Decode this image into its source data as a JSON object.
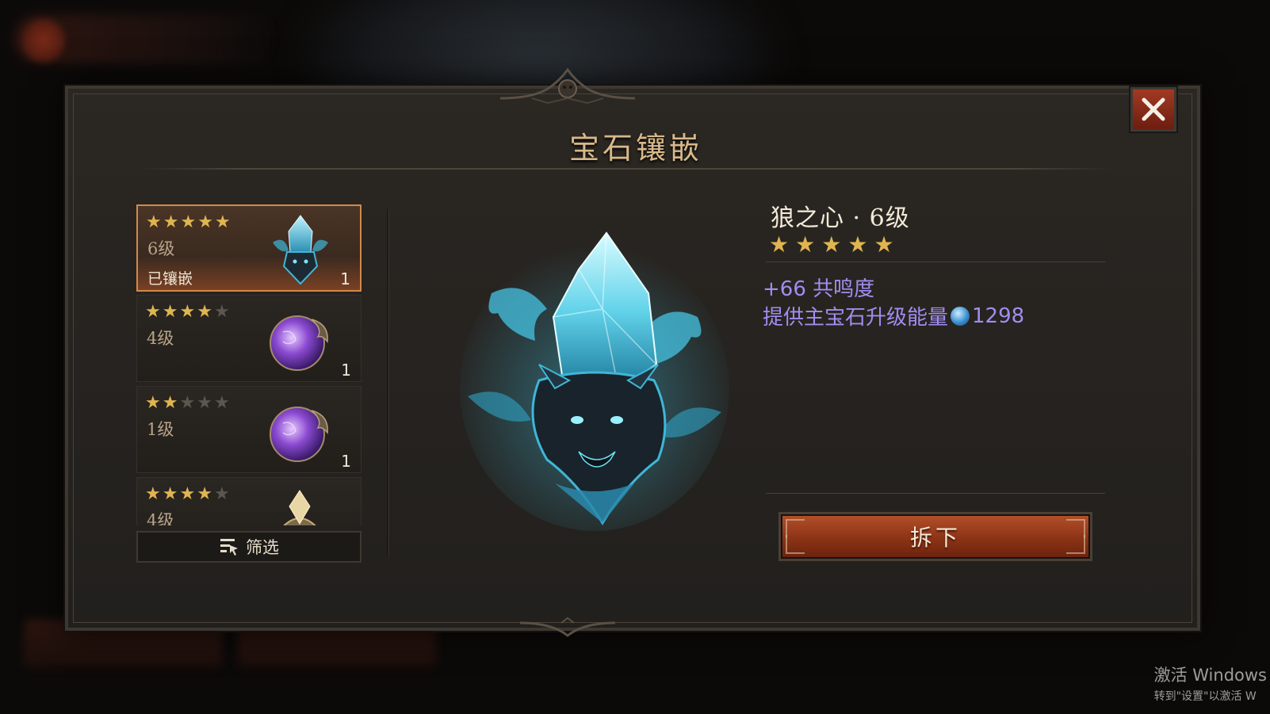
{
  "dialog": {
    "title": "宝石镶嵌",
    "close_label": "×"
  },
  "gem_list": [
    {
      "stars": 5,
      "max_stars": 5,
      "level": "6级",
      "status": "已镶嵌",
      "count": "1",
      "icon": "wolf-crystal-gem-icon",
      "selected": true
    },
    {
      "stars": 4,
      "max_stars": 5,
      "level": "4级",
      "status": "",
      "count": "1",
      "icon": "purple-orb-gem-icon",
      "selected": false
    },
    {
      "stars": 2,
      "max_stars": 5,
      "level": "1级",
      "status": "",
      "count": "1",
      "icon": "purple-orb-gem-icon",
      "selected": false
    },
    {
      "stars": 4,
      "max_stars": 5,
      "level": "4级",
      "status": "",
      "count": "",
      "icon": "gold-gem-icon",
      "selected": false
    }
  ],
  "filter_button": {
    "label": "筛选",
    "icon": "filter-icon"
  },
  "detail": {
    "name": "狼之心 · 6级",
    "stars": 5,
    "stat_resonance": "+66 共鸣度",
    "stat_energy_label": "提供主宝石升级能量",
    "stat_energy_value": "1298",
    "energy_icon": "energy-orb-icon"
  },
  "remove_button": {
    "label": "拆下"
  },
  "watermark": {
    "line1": "激活 Windows",
    "line2": "转到\"设置\"以激活 W"
  },
  "colors": {
    "accent_gold": "#d7b889",
    "star": "#e0b550",
    "stat_purple": "#9f8ef0",
    "button_red": "#8c3316"
  }
}
